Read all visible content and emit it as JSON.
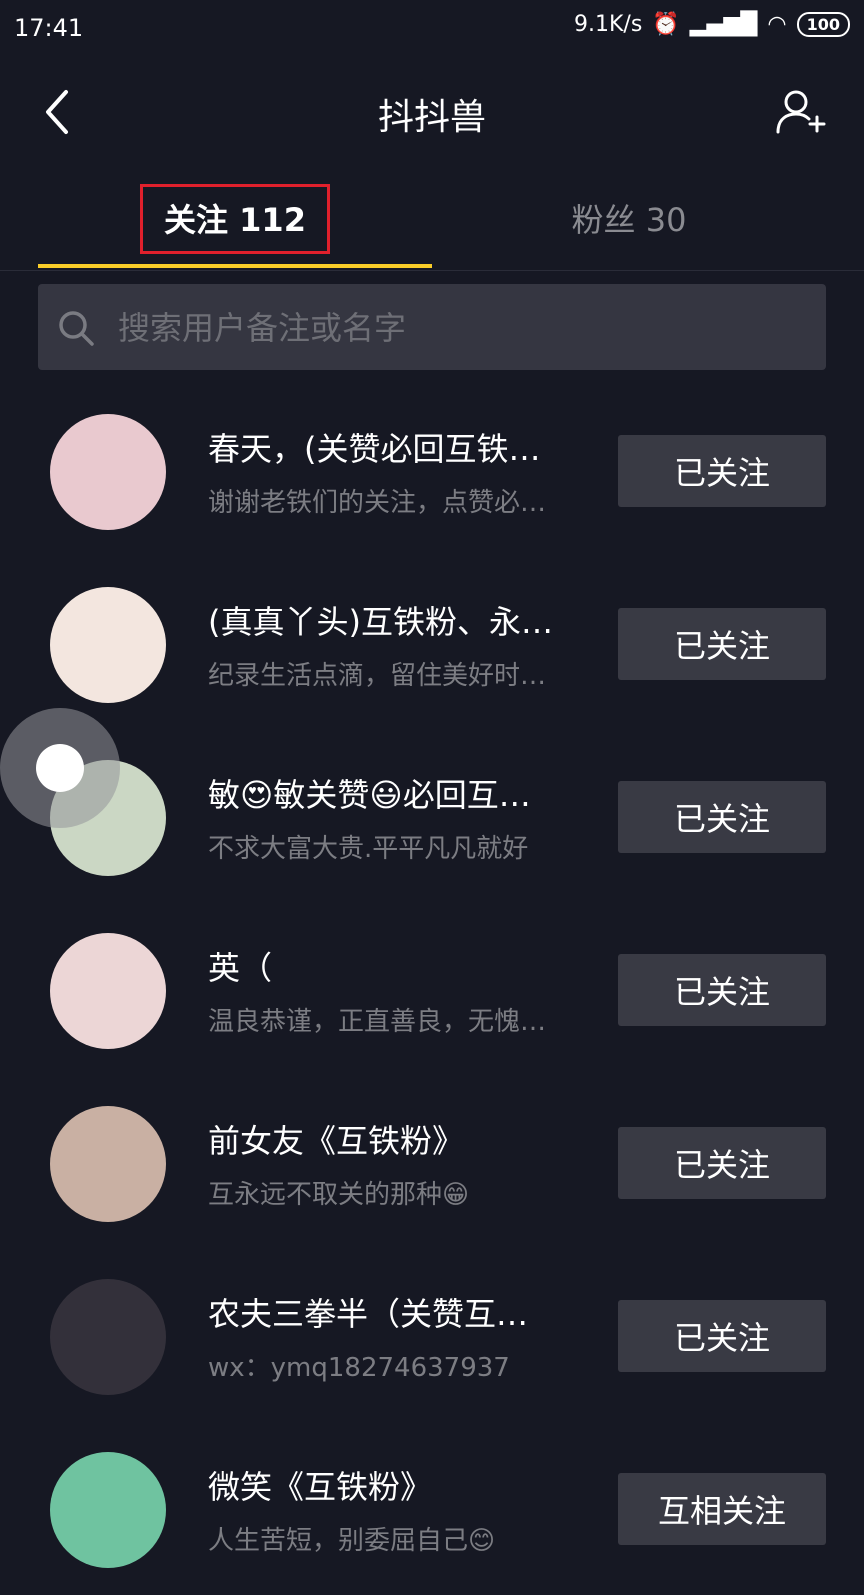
{
  "status": {
    "time": "17:41",
    "speed": "9.1K/s",
    "battery": "100"
  },
  "nav": {
    "title": "抖抖兽"
  },
  "tabs": {
    "following": "关注 112",
    "fans": "粉丝 30"
  },
  "search": {
    "placeholder": "搜索用户备注或名字"
  },
  "users": [
    {
      "name": "春天，(关赞必回互铁…",
      "bio": "谢谢老铁们的关注，点赞必…",
      "button": "已关注",
      "avatar_color": "#e9c9cf"
    },
    {
      "name": "(真真丫头)互铁粉、永…",
      "bio": "纪录生活点滴，留住美好时…",
      "button": "已关注",
      "avatar_color": "#f3e6df"
    },
    {
      "name": "敏😍敏关赞😃必回互…",
      "bio": "不求大富大贵.平平凡凡就好",
      "button": "已关注",
      "avatar_color": "#cbd7c4"
    },
    {
      "name": "英（",
      "bio": "温良恭谨，正直善良，无愧…",
      "button": "已关注",
      "avatar_color": "#ecd6d6"
    },
    {
      "name": "前女友《互铁粉》",
      "bio": "互永远不取关的那种😁",
      "button": "已关注",
      "avatar_color": "#c9b0a3"
    },
    {
      "name": "农夫三拳半（关赞互…",
      "bio": "wx：ymq18274637937",
      "button": "已关注",
      "avatar_color": "#33303a"
    },
    {
      "name": "微笑《互铁粉》",
      "bio": "人生苦短，别委屈自己😊",
      "button": "互相关注",
      "avatar_color": "#6fc3a0"
    }
  ]
}
